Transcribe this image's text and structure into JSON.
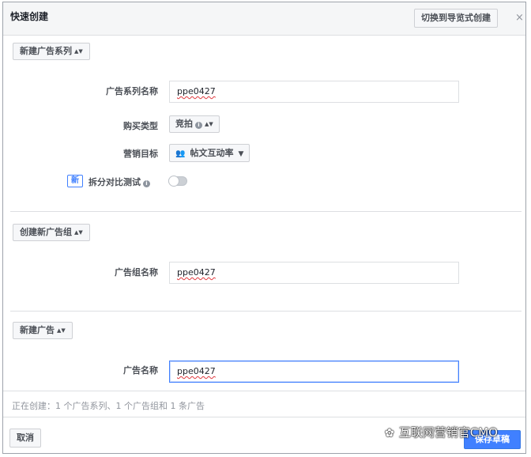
{
  "dialog": {
    "title": "快速创建",
    "switch_button": "切换到导览式创建",
    "close_glyph": "×"
  },
  "campaign": {
    "section_button": "新建广告系列",
    "name_label": "广告系列名称",
    "name_value": "ppe0427",
    "buy_type_label": "购买类型",
    "buy_type_value": "竞拍",
    "objective_label": "营销目标",
    "objective_value": "帖文互动率",
    "objective_icon": "people-icon",
    "split_test_badge": "新",
    "split_test_label": "拆分对比测试",
    "split_test_enabled": false
  },
  "adset": {
    "section_button": "创建新广告组",
    "name_label": "广告组名称",
    "name_value": "ppe0427"
  },
  "ad": {
    "section_button": "新建广告",
    "name_label": "广告名称",
    "name_value": "ppe0427"
  },
  "footer": {
    "summary": "正在创建：1 个广告系列、1 个广告组和 1 条广告",
    "cancel_button": "取消",
    "save_button": "保存草稿"
  },
  "watermark": {
    "text": "互联网营销官CMO"
  },
  "colors": {
    "accent": "#4080ff",
    "title_bar": "#f5f6f7",
    "border": "#dddfe2"
  }
}
